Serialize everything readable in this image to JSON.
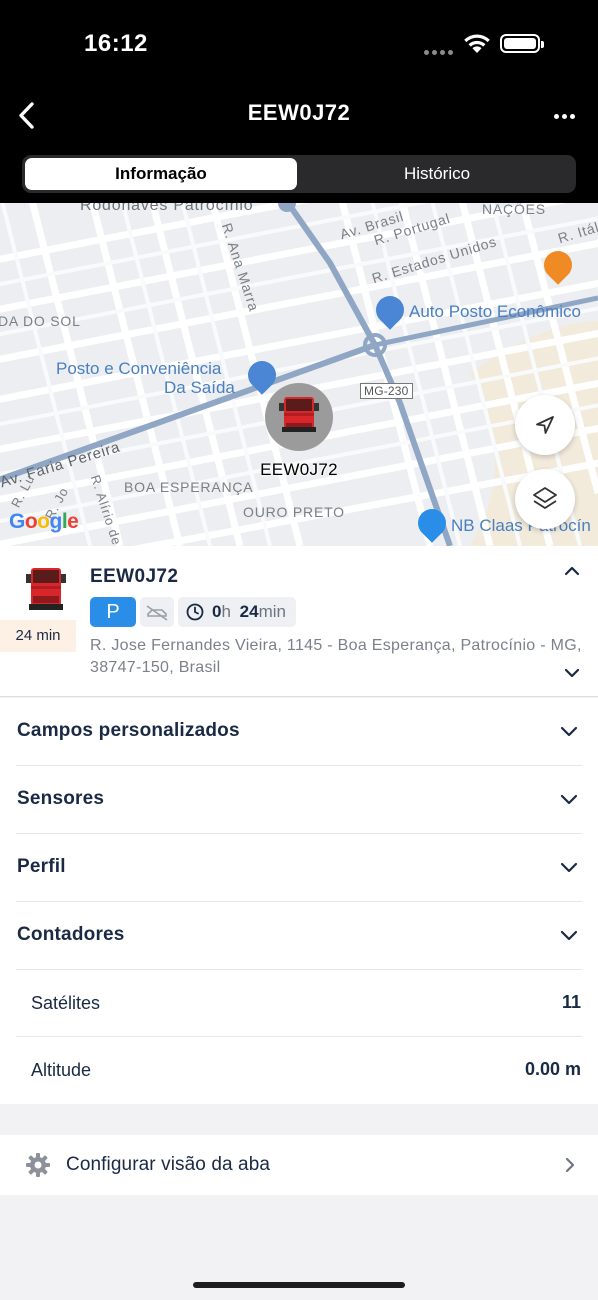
{
  "status_bar": {
    "time": "16:12"
  },
  "header": {
    "title": "EEW0J72"
  },
  "tabs": [
    {
      "label": "Informação",
      "active": true
    },
    {
      "label": "Histórico",
      "active": false
    }
  ],
  "map": {
    "labels": {
      "rodonaves": "Rodonaves Patrocínio",
      "av_brasil": "Av. Brasil",
      "r_portugal": "R. Portugal",
      "nacoes": "NAÇÕES",
      "r_italia": "R. Itália",
      "r_ana_marra": "R. Ana Marra",
      "r_estados_unidos": "R. Estados Unidos",
      "auto_posto": "Auto Posto Econômico",
      "da_do_sol": "DA DO SOL",
      "posto_conv_1": "Posto e Conveniência",
      "posto_conv_2": "Da Saída",
      "mg230": "MG-230",
      "av_faria_pereira": "Av. Faria Pereira",
      "r_lu": "R. Lu",
      "r_jo": "R. Jo",
      "r_alirio": "R. Alírio de M",
      "boa_esperanca": "BOA ESPERANÇA",
      "ouro_preto": "OURO PRETO",
      "nb_claas": "NB Claas Patrocín",
      "google": "Google"
    },
    "marker_label": "EEW0J72"
  },
  "vehicle": {
    "name": "EEW0J72",
    "duration": "24 min",
    "status_badge": "P",
    "stopped_hours": "0",
    "hours_unit": "h",
    "stopped_minutes": "24",
    "minutes_unit": "min",
    "address": "R. Jose Fernandes Vieira, 1145 - Boa Esperança, Patrocínio - MG, 38747-150, Brasil"
  },
  "sections": [
    {
      "label": "Campos personalizados"
    },
    {
      "label": "Sensores"
    },
    {
      "label": "Perfil"
    },
    {
      "label": "Contadores"
    }
  ],
  "counters": [
    {
      "label": "Satélites",
      "value": "11"
    },
    {
      "label": "Altitude",
      "value": "0.00 m"
    }
  ],
  "config": {
    "label": "Configurar visão da aba"
  },
  "colors": {
    "accent_blue": "#2a8ee8",
    "text_primary": "#1a2a44",
    "truck_red": "#d8262b",
    "duration_bg": "#fdf1e6"
  }
}
